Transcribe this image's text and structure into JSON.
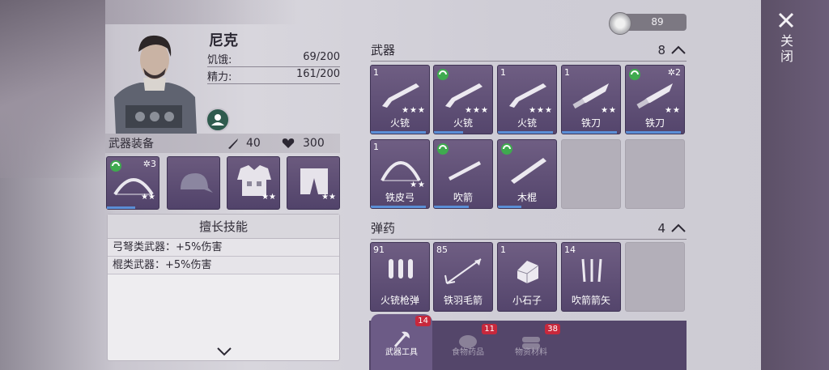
{
  "currency": {
    "amount": "89",
    "icon": "silver-coin-icon"
  },
  "character": {
    "name": "尼克",
    "stats": [
      {
        "label": "饥饿:",
        "value": "69/200"
      },
      {
        "label": "精力:",
        "value": "161/200"
      }
    ]
  },
  "equipment": {
    "title": "武器装备",
    "attack": "40",
    "health": "300",
    "slots": [
      {
        "name": "bow",
        "stars": "★★",
        "gear": "3"
      },
      {
        "name": "cap"
      },
      {
        "name": "vest",
        "stars": "★★"
      },
      {
        "name": "pants",
        "stars": "★★"
      }
    ]
  },
  "skills": {
    "title": "擅长技能",
    "lines": [
      "弓弩类武器：+5%伤害",
      "棍类武器：+5%伤害"
    ]
  },
  "weapons": {
    "title": "武器",
    "count": "8",
    "items": [
      {
        "qty": "1",
        "label": "火铳",
        "stars": "★★★",
        "durability": 0.95
      },
      {
        "qty": "",
        "label": "火铳",
        "stars": "★★★",
        "durability": 0.5
      },
      {
        "qty": "1",
        "label": "火铳",
        "stars": "★★★",
        "durability": 0.95
      },
      {
        "qty": "1",
        "label": "铁刀",
        "stars": "★★",
        "durability": 0.95
      },
      {
        "qty": "",
        "label": "铁刀",
        "stars": "★★",
        "durability": 0.95,
        "gear": "2"
      },
      {
        "qty": "1",
        "label": "铁皮弓",
        "stars": "★★",
        "durability": 0.95
      },
      {
        "qty": "",
        "label": "吹箭",
        "stars": "",
        "durability": 0.6
      },
      {
        "qty": "",
        "label": "木棍",
        "stars": "",
        "durability": 0.4
      }
    ]
  },
  "ammo": {
    "title": "弹药",
    "count": "4",
    "items": [
      {
        "qty": "91",
        "label": "火铳枪弹"
      },
      {
        "qty": "85",
        "label": "铁羽毛箭"
      },
      {
        "qty": "1",
        "label": "小石子"
      },
      {
        "qty": "14",
        "label": "吹箭箭矢"
      }
    ]
  },
  "tabs": [
    {
      "label": "武器工具",
      "badge": "14",
      "active": true
    },
    {
      "label": "食物药品",
      "badge": "11"
    },
    {
      "label": "物资材料",
      "badge": "38"
    }
  ],
  "close_label": "关闭"
}
